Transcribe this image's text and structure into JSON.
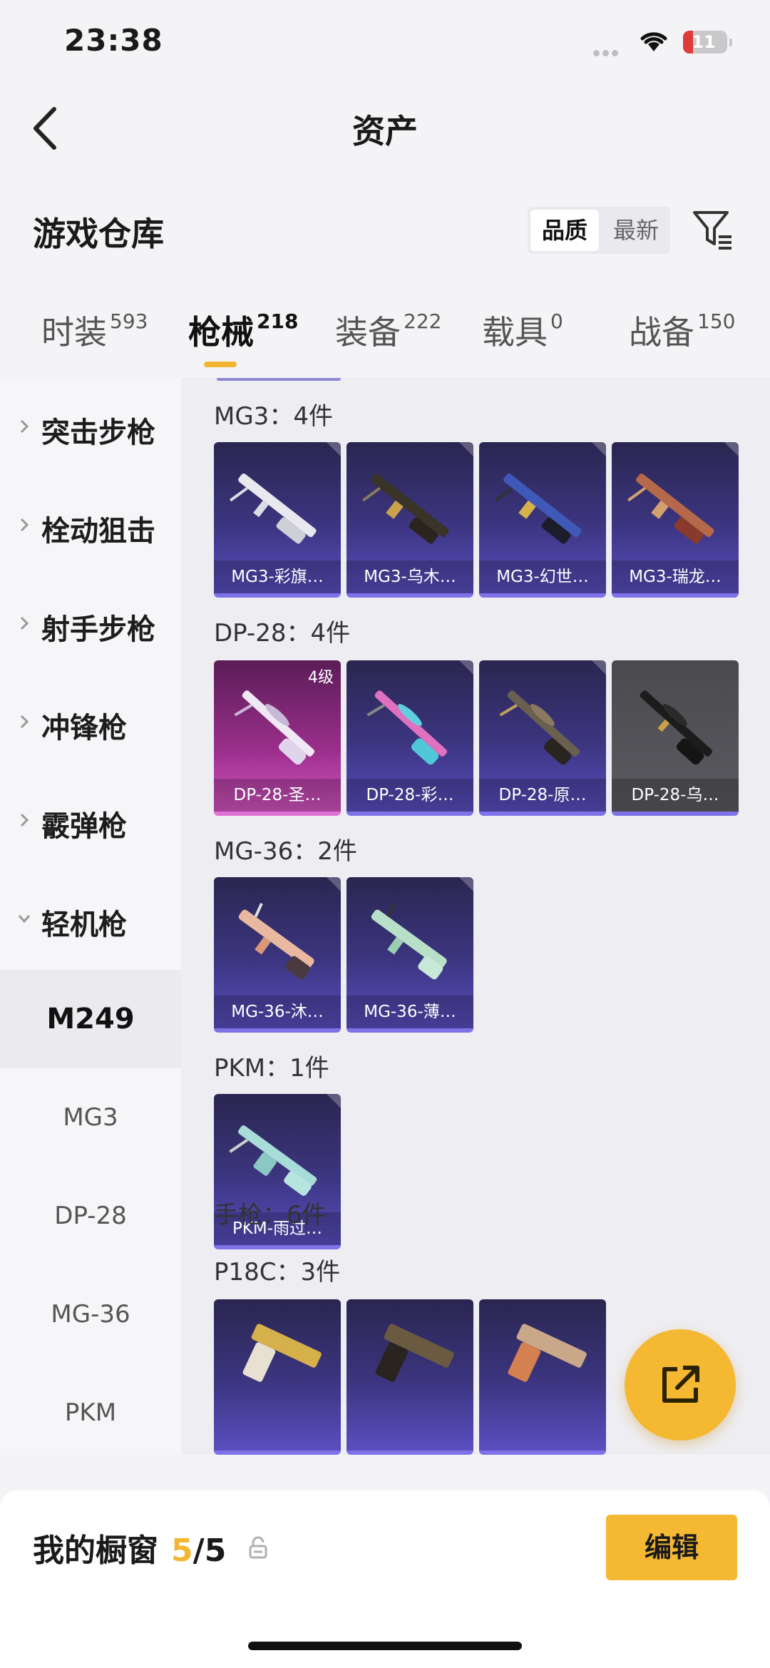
{
  "status_bar": {
    "time": "23:38",
    "battery": "11"
  },
  "header": {
    "title": "资产"
  },
  "section": {
    "title": "游戏仓库"
  },
  "sort": {
    "options": [
      "品质",
      "最新"
    ],
    "selected": "品质"
  },
  "tabs": [
    {
      "label": "时装",
      "count": "593"
    },
    {
      "label": "枪械",
      "count": "218"
    },
    {
      "label": "装备",
      "count": "222"
    },
    {
      "label": "载具",
      "count": "0"
    },
    {
      "label": "战备",
      "count": "150"
    }
  ],
  "active_tab": "枪械",
  "sidebar": {
    "categories": [
      "突击步枪",
      "栓动狙击",
      "射手步枪",
      "冲锋枪",
      "霰弹枪",
      "轻机枪"
    ],
    "subitems": [
      "M249",
      "MG3",
      "DP-28",
      "MG-36",
      "PKM"
    ],
    "active_subitem": "M249"
  },
  "groups": [
    {
      "label": "MG3：4件",
      "items": [
        "MG3-彩旗…",
        "MG3-乌木…",
        "MG3-幻世…",
        "MG3-瑞龙…"
      ]
    },
    {
      "label": "DP-28：4件",
      "items": [
        "DP-28-圣…",
        "DP-28-彩…",
        "DP-28-原…",
        "DP-28-乌…"
      ],
      "first_level": "4级"
    },
    {
      "label": "MG-36：2件",
      "items": [
        "MG-36-沐…",
        "MG-36-薄…"
      ]
    },
    {
      "label": "PKM：1件",
      "items": [
        "PKM-雨过…"
      ]
    },
    {
      "label": "手枪：6件",
      "items": []
    },
    {
      "label": "P18C：3件",
      "items": []
    }
  ],
  "bottom_bar": {
    "showcase_label": "我的橱窗",
    "current": "5",
    "total": "/5",
    "edit_label": "编辑"
  },
  "colors": {
    "accent": "#f2b632",
    "card_blue": "#3c3580",
    "card_pink": "#9b2f8c"
  }
}
